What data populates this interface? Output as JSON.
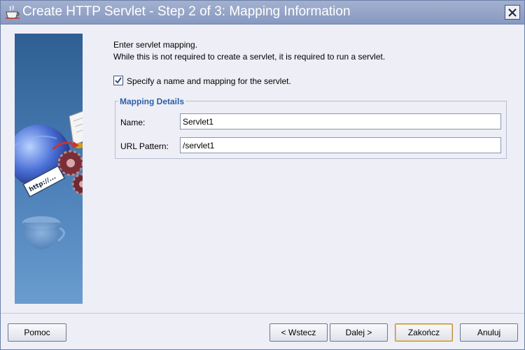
{
  "window": {
    "title": "Create HTTP Servlet - Step 2 of 3: Mapping Information",
    "title_icon": "coffee-cup-icon",
    "close_icon": "close-icon"
  },
  "banner": {
    "icon": "servlet-wizard-graphic",
    "url_tag": "http://..."
  },
  "content": {
    "intro_line1": "Enter servlet mapping.",
    "intro_line2": "While this is not required to create a servlet, it is required to run a servlet.",
    "checkbox_label": "Specify a name and mapping for the servlet.",
    "checkbox_checked": true
  },
  "mapping": {
    "group_title": "Mapping Details",
    "name_label": "Name:",
    "name_value": "Servlet1",
    "url_label": "URL Pattern:",
    "url_value": "/servlet1"
  },
  "buttons": {
    "help": "Pomoc",
    "back": "< Wstecz",
    "next": "Dalej >",
    "finish": "Zakończ",
    "cancel": "Anuluj"
  },
  "colors": {
    "titlebar": "#8799c1",
    "background": "#eeeef6",
    "group_title": "#2d5fa6",
    "banner": "#4c80b8"
  }
}
